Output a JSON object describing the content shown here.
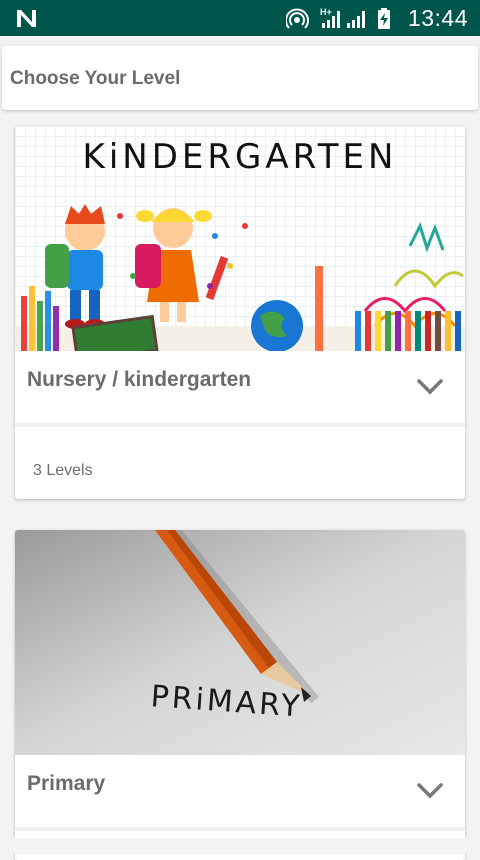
{
  "status_bar": {
    "time": "13:44",
    "network_label": "H+",
    "icons": [
      "notification-n-icon",
      "hotspot-icon",
      "signal-h-plus-icon",
      "signal-icon",
      "battery-charging-icon"
    ]
  },
  "header": {
    "title": "Choose Your Level"
  },
  "levels": [
    {
      "name": "Nursery / kindergarten",
      "image_text": "KiNDERGARTEN",
      "count_label": "3 Levels"
    },
    {
      "name": "Primary",
      "image_text": "PRiMARY"
    }
  ],
  "colors": {
    "status_bar": "#00564a",
    "card_text": "#6b6b6b",
    "background": "#f3f3f3"
  }
}
